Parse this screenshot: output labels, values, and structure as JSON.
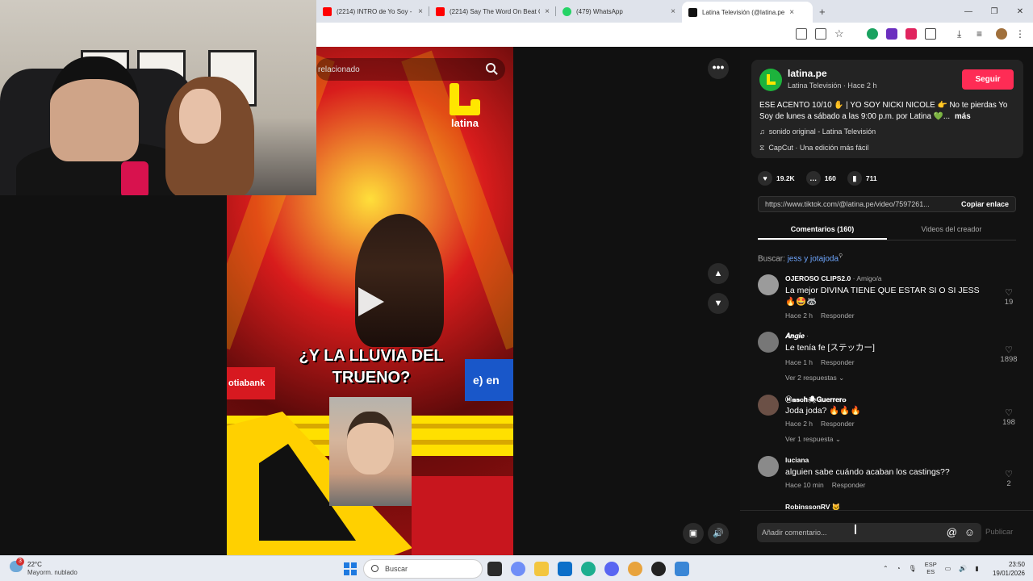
{
  "browser": {
    "tabs": [
      {
        "label": "(2214) INTRO de Yo Soy - YouT",
        "color": "#ff0000"
      },
      {
        "label": "(2214) Say The Word On Beat C",
        "color": "#ff0000"
      },
      {
        "label": "(479) WhatsApp",
        "color": "#25d366"
      },
      {
        "label": "Latina Televisión (@latina.pe",
        "color": "#111111"
      }
    ],
    "close_glyph": "×",
    "new_tab_glyph": "+"
  },
  "video": {
    "search_placeholder": "relacionado",
    "logo_text": "latina",
    "subtitle": "¿Y LA LLUVIA DEL TRUENO?",
    "sponsor_left": "otiabank",
    "sponsor_right": "e) en"
  },
  "post": {
    "account": "latina.pe",
    "account_sub": "Latina Televisión · Hace 2 h",
    "follow_label": "Seguir",
    "description": "ESE ACENTO 10/10 ✋ | YO SOY NICKI NICOLE 👉 No te pierdas Yo Soy de lunes a sábado a las 9:00 p.m. por Latina 💚...",
    "more_label": "más",
    "sound": "sonido original - Latina Televisión",
    "capcut": "CapCut · Una edición más fácil",
    "likes": "19.2K",
    "comments_count": "160",
    "saves": "711",
    "url": "https://www.tiktok.com/@latina.pe/video/7597261...",
    "copy_label": "Copiar enlace",
    "tab_comments": "Comentarios (160)",
    "tab_videos": "Videos del creador",
    "search_prefix": "Buscar:",
    "search_term": "jess y jotajoda"
  },
  "comments": [
    {
      "name": "OJEROSO CLIPS2.0",
      "tag": "· Amigo/a",
      "text": "La mejor DIVINA TIENE QUE ESTAR SI O SI JESS 🔥🤩🦝",
      "time": "Hace 2 h",
      "reply": "Responder",
      "likes": "19",
      "avatar": "#9b9b9b"
    },
    {
      "name": "𝑨𝒏𝒈𝒊𝒆",
      "tag": "·",
      "text": "Le tenía fe [ステッカー]",
      "time": "Hace 1 h",
      "reply": "Responder",
      "likes": "1898",
      "replies": "Ver 2 respuestas",
      "avatar": "#777777"
    },
    {
      "name": "Ⓜ𝐚𝐬𝐜𝐡🕷𝐆𝐮𝐞𝐫𝐫𝐞𝐫𝐨",
      "tag": "",
      "text": "Joda joda? 🔥🔥🔥",
      "time": "Hace 2 h",
      "reply": "Responder",
      "likes": "198",
      "replies": "Ver 1 respuesta",
      "avatar": "#6b5046"
    },
    {
      "name": "luciana",
      "tag": "",
      "text": "alguien sabe cuándo acaban los castings??",
      "time": "Hace 10 min",
      "reply": "Responder",
      "likes": "2",
      "avatar": "#8a8a8a"
    },
    {
      "name": "RobinssonRV 🐱",
      "tag": "",
      "text": "",
      "time": "",
      "reply": "",
      "likes": "",
      "avatar": "#555555"
    }
  ],
  "composer": {
    "placeholder": "Añadir comentario...",
    "at_glyph": "@",
    "emoji_glyph": "☺",
    "publish_label": "Publicar"
  },
  "taskbar": {
    "weather_badge": "3",
    "temp": "22°C",
    "condition": "Mayorm. nublado",
    "search_label": "Buscar",
    "lang_top": "ESP",
    "lang_bottom": "ES",
    "time": "23:50",
    "date": "19/01/2026",
    "apps": [
      "#2b2b2b",
      "#6f8ef7",
      "#f3c63f",
      "#0b6fc9",
      "#1cae8f",
      "#5865f2",
      "#e8a33d",
      "#222222",
      "#3a86d6"
    ]
  },
  "colors": {
    "accent": "#fe2c55",
    "brand_green": "#1db33c",
    "link_blue": "#6ea6ff"
  }
}
